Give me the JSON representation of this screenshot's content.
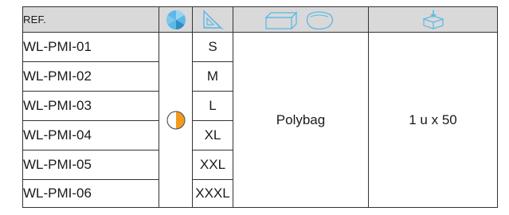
{
  "table": {
    "header": {
      "ref_label": "REF.",
      "color_icon": "color-wheel-icon",
      "size_icon": "set-square-ruler-icon",
      "packaging_icon": "box-and-bag-icon",
      "units_icon": "open-box-with-arrow-icon"
    },
    "rows": [
      {
        "ref": "WL-PMI-01",
        "size": "S"
      },
      {
        "ref": "WL-PMI-02",
        "size": "M"
      },
      {
        "ref": "WL-PMI-03",
        "size": "L"
      },
      {
        "ref": "WL-PMI-04",
        "size": "XL"
      },
      {
        "ref": "WL-PMI-05",
        "size": "XXL"
      },
      {
        "ref": "WL-PMI-06",
        "size": "XXXL"
      }
    ],
    "color_swatch": {
      "icon": "half-orange-circle-icon",
      "colors": [
        "#ffffff",
        "#f39a1f"
      ]
    },
    "packaging": "Polybag",
    "units": "1 u x 50"
  },
  "colors": {
    "header_bg": "#d9d9d9",
    "icon_blue": "#5cb8e6",
    "swatch_orange": "#f39a1f"
  }
}
